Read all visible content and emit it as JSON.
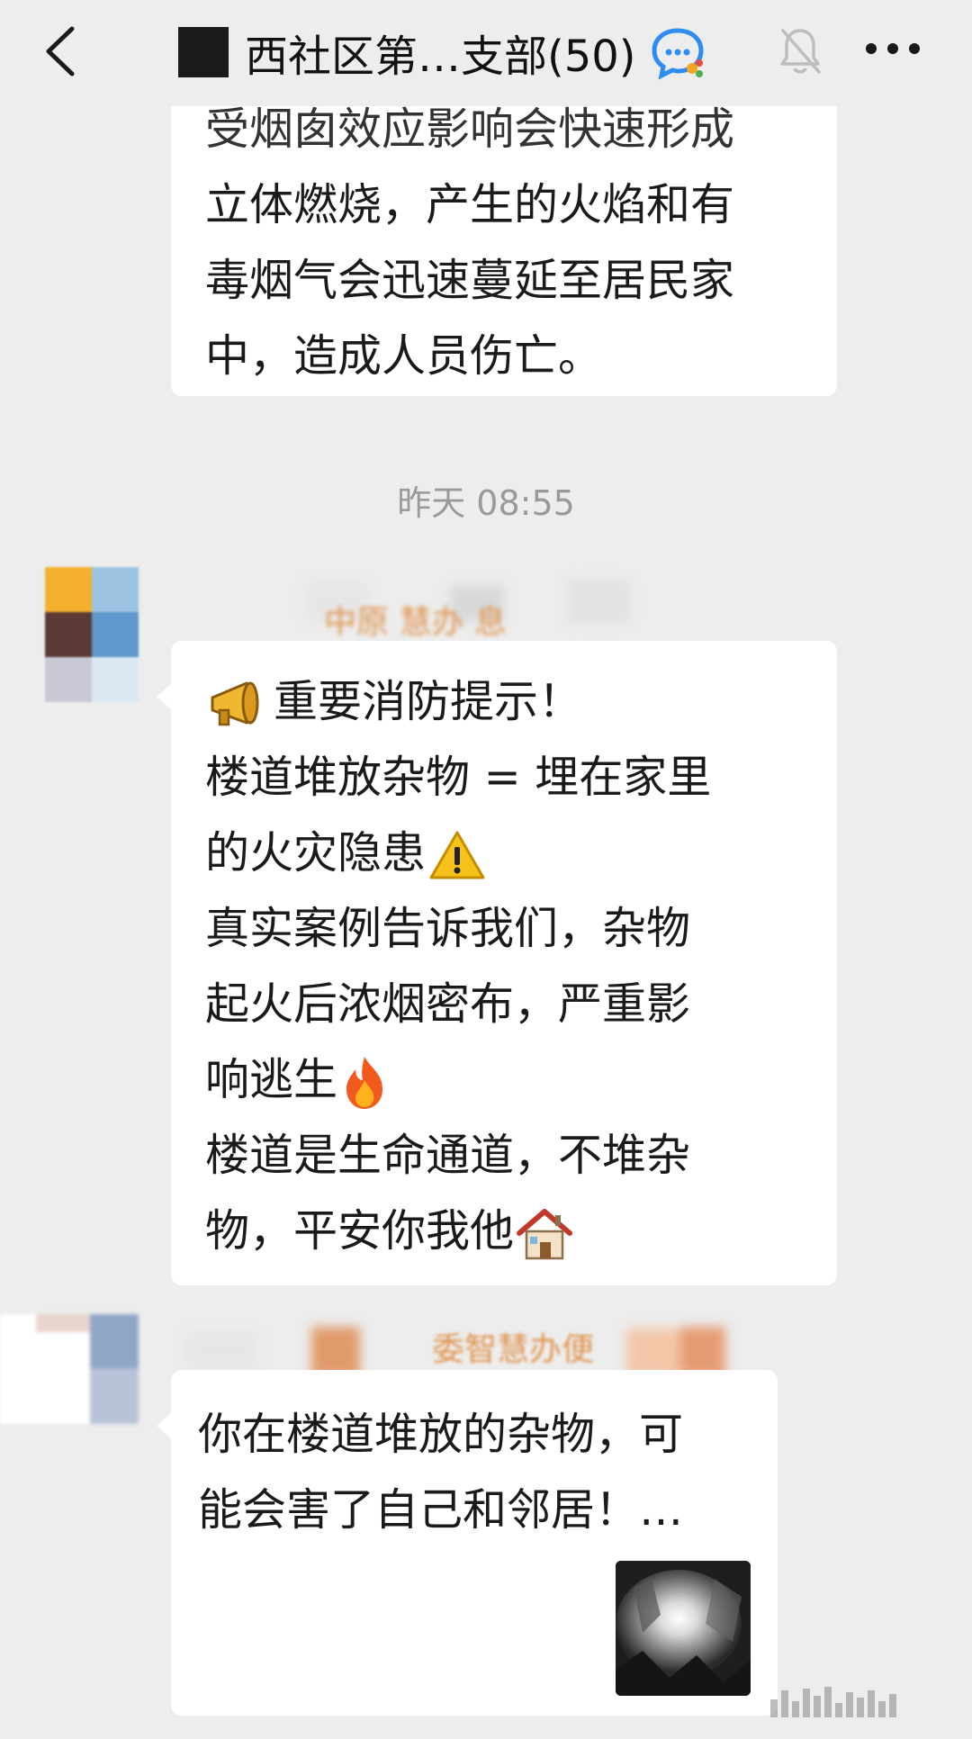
{
  "header": {
    "title": "西社区第…支部(50)",
    "back_icon": "chevron-left-icon",
    "badge_icon": "group-chat-badge-icon",
    "mute_icon": "bell-muted-icon",
    "more_icon": "more-dots-icon"
  },
  "messages": [
    {
      "lines": [
        "受烟囱效应影响会快速形成",
        "立体燃烧，产生的火焰和有",
        "毒烟气会迅速蔓延至居民家",
        "中，造成人员伤亡。"
      ]
    },
    {
      "sender": "中原    慧办     息",
      "lines": [
        "重要消防提示！",
        "楼道堆放杂物 = 埋在家里",
        "的火灾隐患",
        "真实案例告诉我们，杂物",
        "起火后浓烟密布，严重影",
        "响逃生",
        "楼道是生命通道，不堆杂",
        "物，平安你我他"
      ],
      "emojis": [
        "megaphone-emoji",
        "warning-emoji",
        "fire-emoji",
        "house-emoji"
      ]
    },
    {
      "sender": "委智慧办便",
      "lines": [
        "你在楼道堆放的杂物，可",
        "能会害了自己和邻居！…"
      ],
      "thumbnail": "fire-scene-thumbnail"
    }
  ],
  "timestamp": "昨天 08:55",
  "colors": {
    "background": "#ededed",
    "bubble": "#ffffff",
    "sender": "#e0944f",
    "timestamp": "#9a9a9a"
  }
}
